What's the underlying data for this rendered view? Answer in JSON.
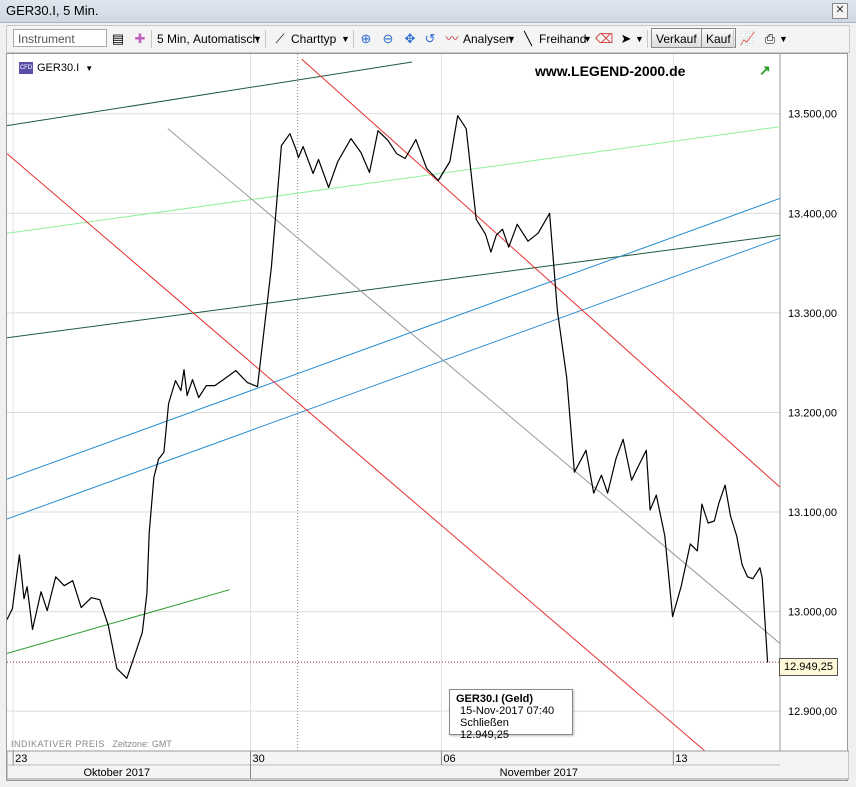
{
  "window": {
    "title": "GER30.I, 5 Min.",
    "close_label": "✕"
  },
  "toolbar": {
    "instrument_placeholder": "Instrument",
    "interval_label": "5 Min,",
    "auto_label": "Automatisch",
    "charttype_label": "Charttyp",
    "analyses_label": "Analysen",
    "freehand_label": "Freihand",
    "sell_label": "Verkauf",
    "buy_label": "Kauf"
  },
  "chart": {
    "symbol": "GER30.I",
    "brand": "www.LEGEND-2000.de",
    "watermark_label": "INDIKATIVER PREIS",
    "timezone_label": "Zeitzone: GMT",
    "last_price_label": "12.949,25",
    "tooltip": {
      "header": "GER30.I (Geld)",
      "datetime": "15-Nov-2017 07:40",
      "close_label": "Schließen",
      "close_value": "12.949,25"
    }
  },
  "chart_data": {
    "type": "line",
    "title": "",
    "xlabel": "",
    "ylabel": "",
    "ylim": [
      12860,
      13560
    ],
    "x_tick_labels": [
      "23",
      "30",
      "06",
      "13"
    ],
    "x_group_labels": [
      "Oktober 2017",
      "November 2017"
    ],
    "y_tick_labels": [
      "12.900,00",
      "13.000,00",
      "13.100,00",
      "13.200,00",
      "13.300,00",
      "13.400,00",
      "13.500,00"
    ],
    "y_ticks": [
      12900,
      13000,
      13100,
      13200,
      13300,
      13400,
      13500
    ],
    "grid": true,
    "x_range": [
      0,
      100
    ],
    "series": [
      {
        "color": "#000000",
        "x": [
          0,
          0.7,
          1.6,
          2.2,
          2.6,
          3.3,
          4.4,
          5.2,
          6.3,
          7.4,
          8.5,
          9.6,
          10.9,
          12.0,
          13.1,
          14.2,
          15.5,
          16.6,
          17.5,
          18.1,
          18.4,
          19.0,
          19.6,
          20.3,
          20.9,
          21.8,
          22.5,
          22.9,
          23.3,
          24.0,
          24.8,
          25.8,
          26.9,
          28.0,
          29.6,
          31.1,
          32.4,
          34.2,
          35.5,
          36.6,
          37.4,
          37.7,
          38.3,
          39.6,
          40.3,
          41.6,
          42.8,
          44.5,
          45.8,
          46.9,
          48.0,
          49.3,
          50.4,
          51.5,
          52.9,
          54.3,
          55.8,
          57.3,
          58.3,
          59.4,
          60.7,
          61.9,
          62.6,
          63.3,
          64.1,
          64.9,
          66.0,
          67.4,
          68.7,
          70.2,
          71.2,
          72.4,
          73.4,
          74.9,
          75.9,
          76.9,
          77.7,
          78.8,
          79.7,
          80.8,
          81.8,
          82.7,
          83.2,
          84.0,
          85.1,
          86.1,
          87.2,
          88.4,
          89.3,
          89.9,
          90.7,
          91.5,
          92.1,
          92.9,
          93.6,
          94.4,
          95.1,
          95.8,
          96.5,
          97.4,
          97.7,
          98.4
        ],
        "y": [
          12992,
          13003,
          13057,
          13013,
          13025,
          12982,
          13020,
          13001,
          13035,
          13026,
          13031,
          13004,
          13014,
          13012,
          12986,
          12943,
          12933,
          12958,
          12979,
          13018,
          13079,
          13135,
          13153,
          13160,
          13209,
          13232,
          13222,
          13243,
          13217,
          13233,
          13215,
          13227,
          13227,
          13233,
          13242,
          13230,
          13226,
          13346,
          13468,
          13480,
          13464,
          13456,
          13467,
          13440,
          13454,
          13426,
          13452,
          13475,
          13461,
          13441,
          13483,
          13473,
          13460,
          13455,
          13474,
          13445,
          13433,
          13452,
          13498,
          13485,
          13394,
          13379,
          13361,
          13378,
          13384,
          13366,
          13389,
          13372,
          13380,
          13400,
          13302,
          13235,
          13140,
          13162,
          13119,
          13137,
          13119,
          13154,
          13173,
          13132,
          13148,
          13162,
          13102,
          13117,
          13076,
          12995,
          13025,
          13068,
          13061,
          13108,
          13089,
          13091,
          13109,
          13127,
          13096,
          13076,
          13047,
          13035,
          13033,
          13044,
          13034,
          12949
        ]
      }
    ],
    "trendlines": [
      {
        "color": "#1e5b3a",
        "from": [
          0,
          13488
        ],
        "to": [
          52.4,
          13552
        ]
      },
      {
        "color": "#1e5b3a",
        "from": [
          0,
          13275
        ],
        "to": [
          100,
          13378
        ]
      },
      {
        "color": "#2e9a2e",
        "from": [
          0,
          12958
        ],
        "to": [
          28.8,
          13022
        ]
      },
      {
        "color": "#8ff09a",
        "from": [
          0,
          13380
        ],
        "to": [
          100,
          13487
        ]
      },
      {
        "color": "#2b8fd6",
        "from": [
          0,
          13133
        ],
        "to": [
          100,
          13415
        ]
      },
      {
        "color": "#2b8fd6",
        "from": [
          0,
          13093
        ],
        "to": [
          100,
          13375
        ]
      },
      {
        "color": "#e63030",
        "from": [
          0,
          13460
        ],
        "to": [
          91.8,
          12850
        ]
      },
      {
        "color": "#e63030",
        "from": [
          38.1,
          13555
        ],
        "to": [
          100,
          13125
        ]
      },
      {
        "color": "#999999",
        "from": [
          20.8,
          13485
        ],
        "to": [
          100,
          12968
        ]
      }
    ],
    "last_price": 12949.25
  }
}
